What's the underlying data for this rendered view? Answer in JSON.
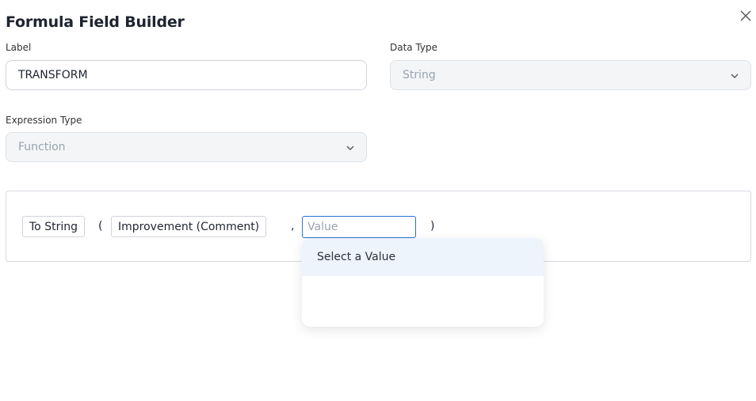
{
  "dialog": {
    "title": "Formula Field Builder",
    "close_icon": "close-icon"
  },
  "form": {
    "label_caption": "Label",
    "label_value": "TRANSFORM",
    "data_type_caption": "Data Type",
    "data_type_value": "String",
    "expression_type_caption": "Expression Type",
    "expression_type_value": "Function"
  },
  "expression": {
    "function_token": "To String",
    "open_paren": "(",
    "argument_token": "Improvement (Comment)",
    "comma": ",",
    "value_placeholder": "Value",
    "close_paren": ")"
  },
  "dropdown": {
    "items": [
      {
        "label": "Select a Value"
      }
    ]
  },
  "colors": {
    "focus_border": "#2e6fd1",
    "highlight": "#eef4fb",
    "disabled_bg": "#f3f5f7"
  }
}
